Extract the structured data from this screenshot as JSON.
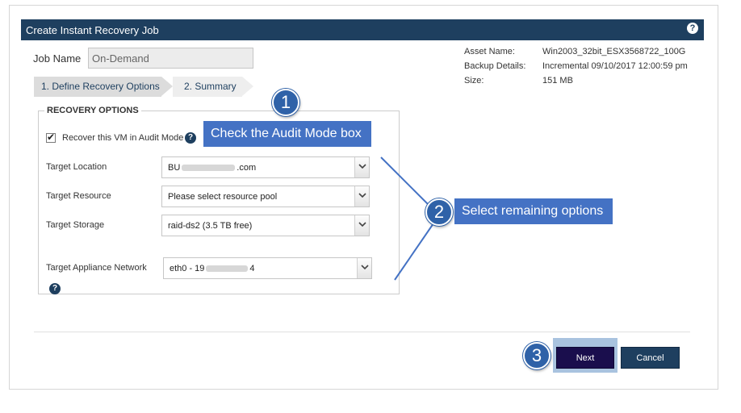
{
  "dialog": {
    "title": "Create Instant Recovery Job",
    "help_glyph": "?"
  },
  "job": {
    "label": "Job Name",
    "value": "On-Demand"
  },
  "steps": [
    {
      "label": "1. Define Recovery Options"
    },
    {
      "label": "2. Summary"
    }
  ],
  "asset": {
    "name_label": "Asset Name:",
    "name_value": "Win2003_32bit_ESX3568722_100G",
    "backup_label": "Backup Details:",
    "backup_value": "Incremental 09/10/2017 12:00:59 pm",
    "size_label": "Size:",
    "size_value": "151 MB"
  },
  "recovery": {
    "legend": "RECOVERY OPTIONS",
    "audit_checkbox": {
      "label": "Recover this VM in Audit Mode",
      "checked": true,
      "tick": "✔"
    },
    "fields": [
      {
        "label": "Target Location",
        "value_prefix": "BU",
        "value_suffix": ".com"
      },
      {
        "label": "Target Resource",
        "value": "Please select resource pool"
      },
      {
        "label": "Target Storage",
        "value": "raid-ds2 (3.5 TB free)"
      },
      {
        "label": "Target Appliance Network",
        "value_prefix": "eth0 - 19",
        "value_suffix": "4"
      }
    ]
  },
  "buttons": {
    "next": "Next",
    "cancel": "Cancel"
  },
  "annotations": [
    {
      "number": "1",
      "text": "Check the Audit Mode box"
    },
    {
      "number": "2",
      "text": "Select remaining options"
    },
    {
      "number": "3"
    }
  ],
  "colors": {
    "titlebar": "#1e3f5f",
    "callout": "#4472c4",
    "circle": "#2f62a8",
    "next_button": "#1a0e4d",
    "cancel_button": "#1e3f5f"
  },
  "icons": {
    "help": "help-icon",
    "dropdown": "chevron-down-icon",
    "check": "checkmark-icon"
  }
}
